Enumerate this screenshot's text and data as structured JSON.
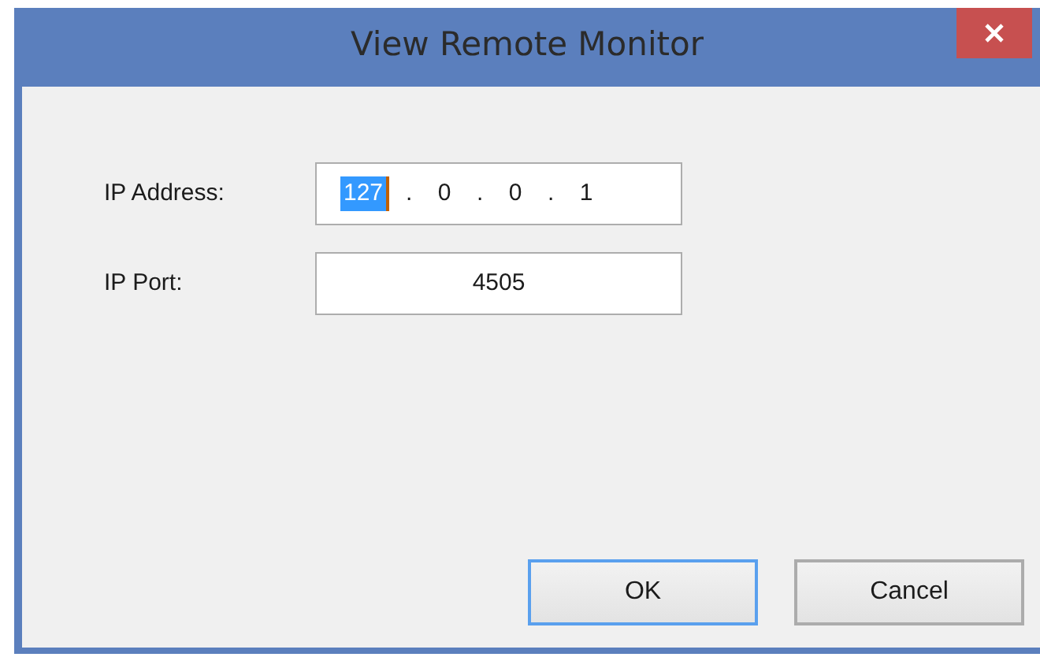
{
  "window": {
    "title": "View Remote Monitor"
  },
  "fields": [
    {
      "kind": "ip",
      "label": "IP Address:",
      "octets": [
        {
          "text": "127",
          "selected": true
        },
        {
          "text": "0",
          "selected": false
        },
        {
          "text": "0",
          "selected": false
        },
        {
          "text": "1",
          "selected": false
        }
      ],
      "separators": [
        ".",
        ".",
        "."
      ]
    },
    {
      "kind": "text",
      "label": "IP Port:",
      "value": "4505"
    }
  ],
  "buttons": [
    {
      "label": "OK",
      "default": true
    },
    {
      "label": "Cancel",
      "default": false
    }
  ]
}
